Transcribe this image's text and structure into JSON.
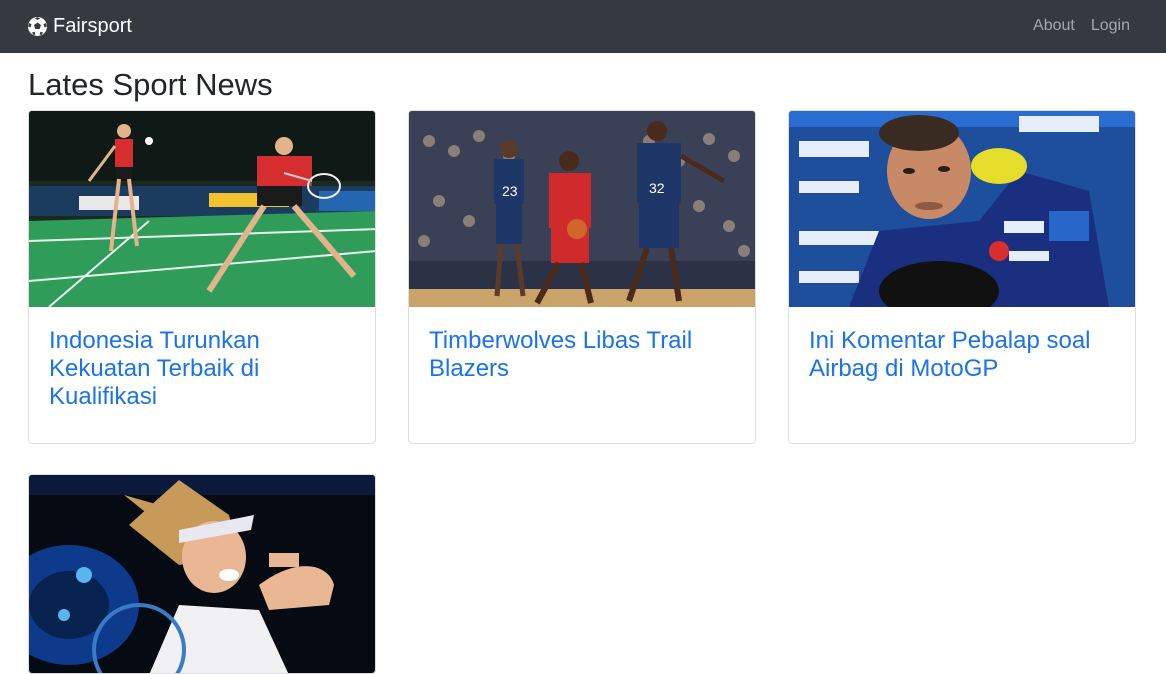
{
  "navbar": {
    "brand": "Fairsport",
    "brand_icon": "soccer-ball-icon",
    "links": [
      "About",
      "Login"
    ]
  },
  "main": {
    "title": "Lates Sport News",
    "articles": [
      {
        "title": "Indonesia Turunkan Kekuatan Terbaik di Kualifikasi",
        "image": "badminton-players-photo"
      },
      {
        "title": "Timberwolves Libas Trail Blazers",
        "image": "basketball-game-photo"
      },
      {
        "title": "Ini Komentar Pebalap soal Airbag di MotoGP",
        "image": "motogp-rider-photo"
      },
      {
        "title": "",
        "image": "tennis-player-photo"
      }
    ]
  },
  "colors": {
    "navbar_bg": "#343a40",
    "link": "#1a73e8",
    "heading": "#212529"
  }
}
